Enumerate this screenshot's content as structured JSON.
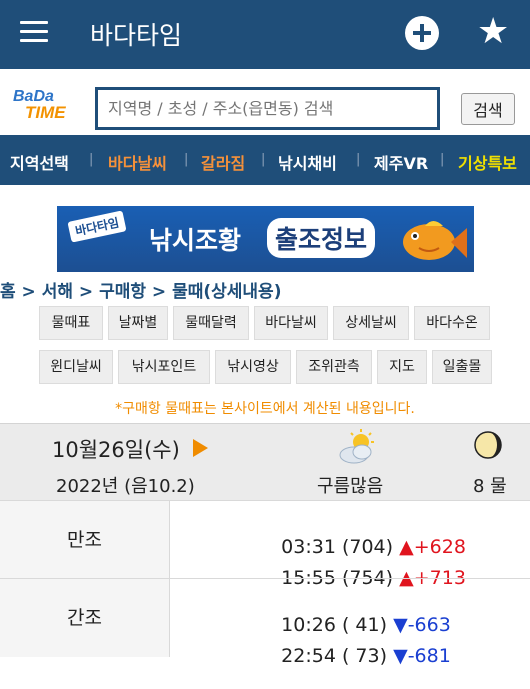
{
  "appbar": {
    "title": "바다타임",
    "menu_icon": "hamburger-icon",
    "add_icon": "plus-circle-icon",
    "favorite_icon": "star-icon"
  },
  "search": {
    "logo_line1": "BaDa",
    "logo_line2": "TIME",
    "placeholder": "지역명 / 초성 / 주소(읍면동) 검색",
    "button": "검색"
  },
  "nav": [
    {
      "label": "지역선택",
      "color": "#ffffff"
    },
    {
      "label": "바다날씨",
      "color": "#f5913a"
    },
    {
      "label": "갈라짐",
      "color": "#f5913a"
    },
    {
      "label": "낚시채비",
      "color": "#ffffff"
    },
    {
      "label": "제주VR",
      "color": "#ffffff"
    },
    {
      "label": "기상특보",
      "color": "#f0e000"
    }
  ],
  "banner": {
    "tag": "바다타임",
    "text1": "낚시조황",
    "text2": "출조정보"
  },
  "breadcrumb": "홈 > 서해 > 구매항 > 물때(상세내용)",
  "buttons_row1": [
    "물때표",
    "날짜별",
    "물때달력",
    "바다날씨",
    "상세날씨",
    "바다수온"
  ],
  "buttons_row2": [
    "윈디날씨",
    "낚시포인트",
    "낚시영상",
    "조위관측",
    "지도",
    "일출몰"
  ],
  "notice": "*구매항 물때표는 본사이트에서 계산된 내용입니다.",
  "day": {
    "date": "10월26일(수)",
    "year": "2022년 (음10.2)",
    "weather_icon": "partly-cloudy-icon",
    "weather": "구름많음",
    "moon_icon": "moon-phase-icon",
    "tide_phase": "8 물"
  },
  "tides": [
    {
      "label": "만조",
      "entries": [
        {
          "time": "03:31 (704) ",
          "arrow": "▲",
          "change": "+628",
          "dir": "up"
        },
        {
          "time": "15:55 (754) ",
          "arrow": "▲",
          "change": "+713",
          "dir": "up"
        }
      ]
    },
    {
      "label": "간조",
      "entries": [
        {
          "time": "10:26 ( 41) ",
          "arrow": "▼",
          "change": "-663",
          "dir": "down"
        },
        {
          "time": "22:54 ( 73) ",
          "arrow": "▼",
          "change": "-681",
          "dir": "down"
        }
      ]
    }
  ],
  "colors": {
    "primary": "#1f4e79",
    "accent": "#f08c00",
    "up": "#e0141e",
    "down": "#1a3fd1"
  }
}
